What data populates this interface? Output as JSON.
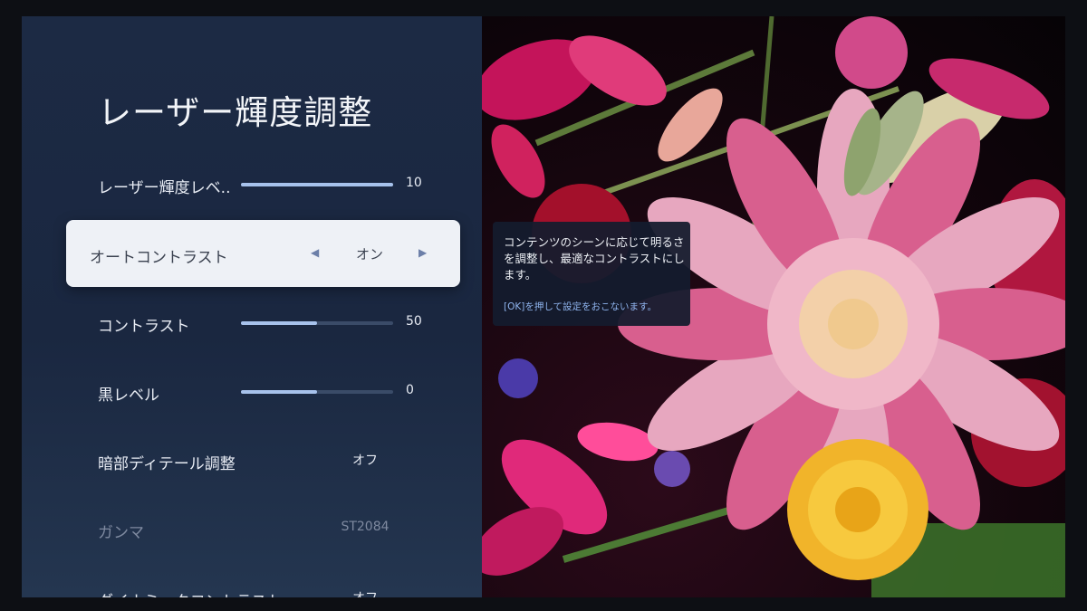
{
  "panel": {
    "title": "レーザー輝度調整",
    "items": [
      {
        "label": "レーザー輝度レベ..",
        "value": "10",
        "level": 1.0
      },
      {
        "label": "オートコントラスト",
        "value": "オン"
      },
      {
        "label": "コントラスト",
        "value": "50",
        "level": 0.5
      },
      {
        "label": "黒レベル",
        "value": "0",
        "level": 0.5
      },
      {
        "label": "暗部ディテール調整",
        "value": "オフ"
      },
      {
        "label": "ガンマ",
        "value": "ST2084"
      },
      {
        "label": "ダイナミックコントラスト",
        "value": "オフ"
      }
    ]
  },
  "tooltip": {
    "description": "コンテンツのシーンに応じて明るさを調整し、最適なコントラストにします。",
    "hint": "[OK]を押して設定をおこないます。"
  },
  "icons": {
    "left_arrow": "triangle-left-icon",
    "right_arrow": "triangle-right-icon"
  },
  "colors": {
    "panel_bg": "#1c2a44",
    "focus_bg": "#eef1f6",
    "slider_fill": "#a7c2ec",
    "hint_text": "#8fb4ee"
  }
}
